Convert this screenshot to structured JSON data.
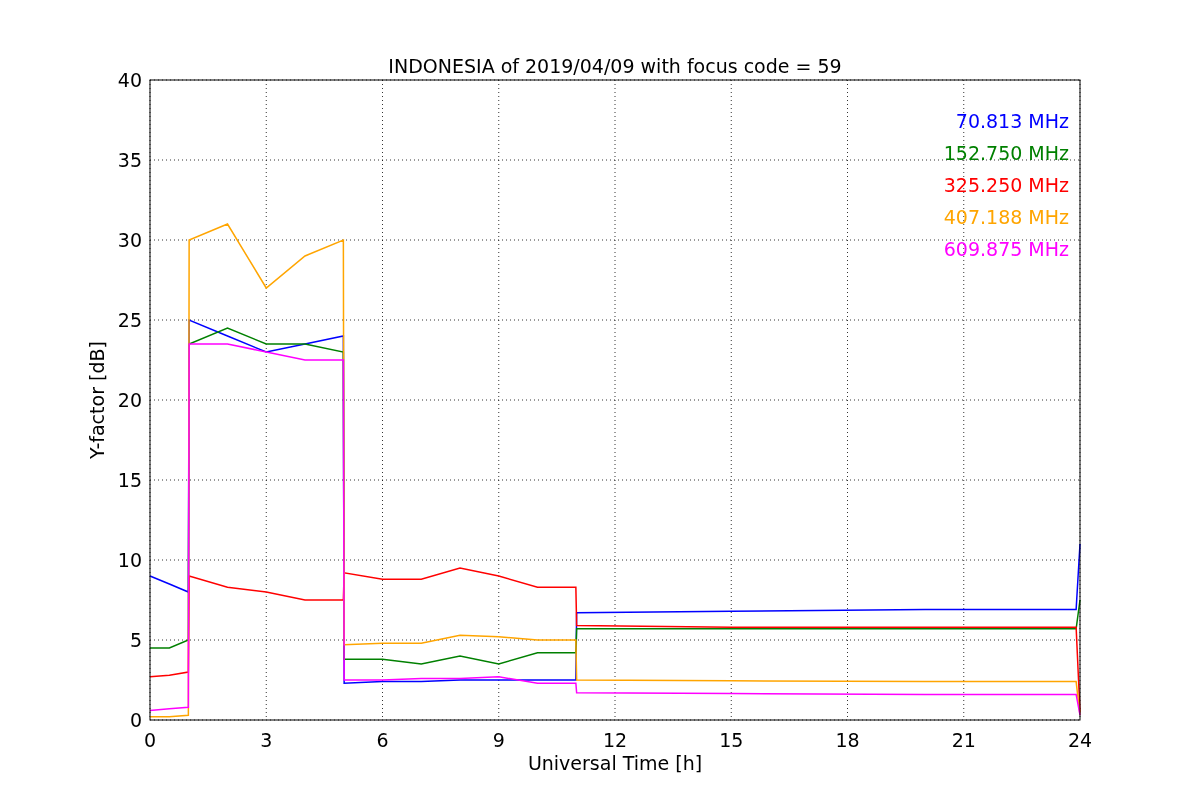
{
  "chart_data": {
    "type": "line",
    "title": "INDONESIA of 2019/04/09 with focus code = 59",
    "xlabel": "Universal Time [h]",
    "ylabel": "Y-factor [dB]",
    "x": [
      0,
      0.5,
      0.99,
      1.01,
      2,
      3,
      4,
      4.99,
      5.01,
      6,
      7,
      8,
      9,
      10,
      10.99,
      11.01,
      15,
      20,
      23.9,
      24
    ],
    "series": [
      {
        "name": "70.813 MHz",
        "color": "#0000ff",
        "values": [
          9,
          8.5,
          8,
          25,
          24,
          23,
          23.5,
          24,
          2.3,
          2.4,
          2.4,
          2.5,
          2.5,
          2.5,
          2.5,
          6.7,
          6.8,
          6.9,
          6.9,
          11
        ]
      },
      {
        "name": "152.750 MHz",
        "color": "#008000",
        "values": [
          4.5,
          4.5,
          5,
          23.5,
          24.5,
          23.5,
          23.5,
          23,
          3.8,
          3.8,
          3.5,
          4,
          3.5,
          4.2,
          4.2,
          5.7,
          5.7,
          5.7,
          5.7,
          7.5
        ]
      },
      {
        "name": "325.250 MHz",
        "color": "#ff0000",
        "values": [
          2.7,
          2.8,
          3,
          9,
          8.3,
          8,
          7.5,
          7.5,
          9.2,
          8.8,
          8.8,
          9.5,
          9,
          8.3,
          8.3,
          5.9,
          5.8,
          5.8,
          5.8,
          0.5
        ]
      },
      {
        "name": "407.188 MHz",
        "color": "#ffa500",
        "values": [
          0.2,
          0.2,
          0.3,
          30,
          31,
          27,
          29,
          30,
          4.7,
          4.8,
          4.8,
          5.3,
          5.2,
          5,
          5,
          2.5,
          2.45,
          2.4,
          2.4,
          0.3
        ]
      },
      {
        "name": "609.875 MHz",
        "color": "#ff00ff",
        "values": [
          0.6,
          0.7,
          0.8,
          23.5,
          23.5,
          23,
          22.5,
          22.5,
          2.5,
          2.5,
          2.6,
          2.6,
          2.7,
          2.3,
          2.3,
          1.7,
          1.65,
          1.6,
          1.6,
          0.3
        ]
      }
    ],
    "grid": true,
    "xlim": [
      0,
      24
    ],
    "ylim": [
      0,
      40
    ],
    "xticks": [
      0,
      3,
      6,
      9,
      12,
      15,
      18,
      21,
      24
    ],
    "yticks": [
      0,
      5,
      10,
      15,
      20,
      25,
      30,
      35,
      40
    ]
  }
}
